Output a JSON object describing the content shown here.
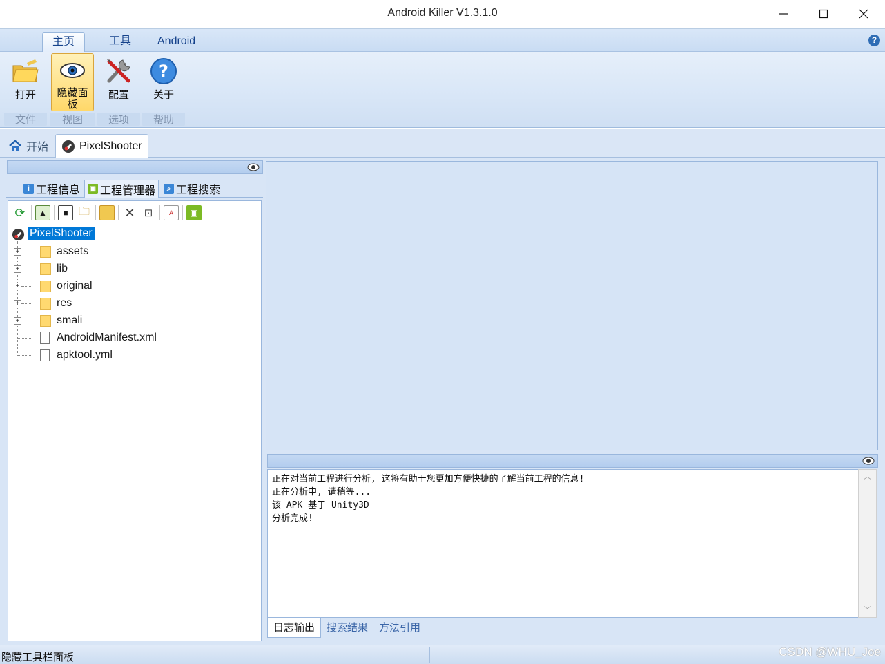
{
  "window": {
    "title": "Android Killer V1.3.1.0"
  },
  "ribbon": {
    "tabs": [
      {
        "label": "主页",
        "active": true
      },
      {
        "label": "工具",
        "active": false
      },
      {
        "label": "Android",
        "active": false
      }
    ],
    "buttons": {
      "open": "打开",
      "hide_panel": "隐藏面板",
      "config": "配置",
      "about": "关于"
    },
    "groups": {
      "file": "文件",
      "view": "视图",
      "options": "选项",
      "help": "帮助"
    }
  },
  "doc_tabs": [
    {
      "label": "开始",
      "icon": "home-icon"
    },
    {
      "label": "PixelShooter",
      "icon": "app-icon",
      "active": true
    }
  ],
  "left_panel": {
    "tabs": [
      {
        "label": "工程信息",
        "icon": "info-icon"
      },
      {
        "label": "工程管理器",
        "icon": "android-icon",
        "active": true
      },
      {
        "label": "工程搜索",
        "icon": "search-icon"
      }
    ],
    "tree": {
      "root": "PixelShooter",
      "folders": [
        "assets",
        "lib",
        "original",
        "res",
        "smali"
      ],
      "files": [
        "AndroidManifest.xml",
        "apktool.yml"
      ]
    }
  },
  "log": {
    "lines": [
      "正在对当前工程进行分析, 这将有助于您更加方便快捷的了解当前工程的信息!",
      "正在分析中, 请稍等...",
      "该 APK 基于 Unity3D",
      "分析完成!"
    ],
    "tabs": [
      {
        "label": "日志输出",
        "active": true
      },
      {
        "label": "搜索结果"
      },
      {
        "label": "方法引用"
      }
    ]
  },
  "status": {
    "text": "隐藏工具栏面板",
    "watermark": "CSDN @WHU_Joe"
  },
  "colors": {
    "accent": "#0078d7",
    "ribbon_bg": "#d8e6f7",
    "active_button": "#ffd86a"
  }
}
